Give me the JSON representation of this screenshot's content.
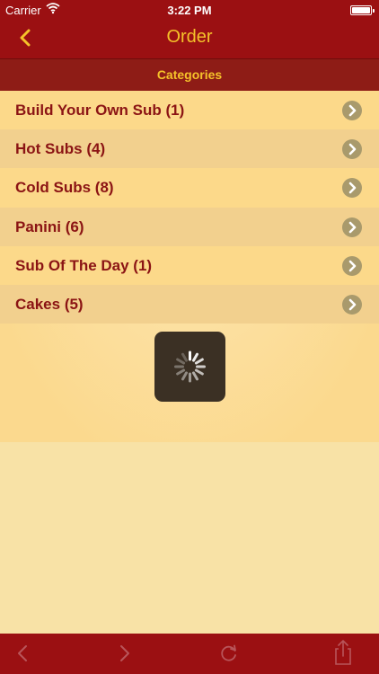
{
  "status_bar": {
    "carrier": "Carrier",
    "time": "3:22 PM",
    "battery_level": 1.0
  },
  "nav": {
    "title": "Order",
    "back_icon": "chevron-left-icon"
  },
  "section": {
    "header": "Categories"
  },
  "categories": [
    {
      "label": "Build Your Own Sub (1)"
    },
    {
      "label": "Hot Subs (4)"
    },
    {
      "label": "Cold Subs (8)"
    },
    {
      "label": "Panini (6)"
    },
    {
      "label": "Sub Of The Day (1)"
    },
    {
      "label": "Cakes (5)"
    }
  ],
  "toolbar": {
    "icons": [
      "back-arrow-icon",
      "forward-arrow-icon",
      "refresh-icon",
      "share-icon"
    ]
  },
  "colors": {
    "bar": "#9b1012",
    "accent": "#f5c22a",
    "label": "#8b1414",
    "row_odd": "#fcd98a",
    "row_even": "#f2d08e",
    "background": "#f8e2a6"
  }
}
